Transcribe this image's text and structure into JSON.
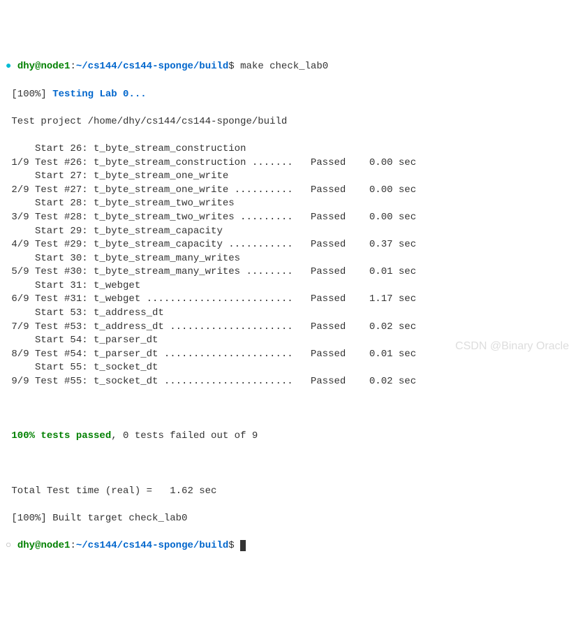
{
  "prompt": {
    "bullet1": "●",
    "bullet2": "○",
    "user": "dhy",
    "at": "@",
    "host": "node1",
    "colon": ":",
    "path": "~/cs144/cs144-sponge/build",
    "dollar": "$",
    "command": "make check_lab0"
  },
  "progress": {
    "label": "[100%]",
    "text": "Testing Lab 0..."
  },
  "project_line": "Test project /home/dhy/cs144/cs144-sponge/build",
  "tests": [
    {
      "start": "    Start 26: t_byte_stream_construction",
      "row": "1/9 Test #26: t_byte_stream_construction .......   Passed    0.00 sec"
    },
    {
      "start": "    Start 27: t_byte_stream_one_write",
      "row": "2/9 Test #27: t_byte_stream_one_write ..........   Passed    0.00 sec"
    },
    {
      "start": "    Start 28: t_byte_stream_two_writes",
      "row": "3/9 Test #28: t_byte_stream_two_writes .........   Passed    0.00 sec"
    },
    {
      "start": "    Start 29: t_byte_stream_capacity",
      "row": "4/9 Test #29: t_byte_stream_capacity ...........   Passed    0.37 sec"
    },
    {
      "start": "    Start 30: t_byte_stream_many_writes",
      "row": "5/9 Test #30: t_byte_stream_many_writes ........   Passed    0.01 sec"
    },
    {
      "start": "    Start 31: t_webget",
      "row": "6/9 Test #31: t_webget .........................   Passed    1.17 sec"
    },
    {
      "start": "    Start 53: t_address_dt",
      "row": "7/9 Test #53: t_address_dt .....................   Passed    0.02 sec"
    },
    {
      "start": "    Start 54: t_parser_dt",
      "row": "8/9 Test #54: t_parser_dt ......................   Passed    0.01 sec"
    },
    {
      "start": "    Start 55: t_socket_dt",
      "row": "9/9 Test #55: t_socket_dt ......................   Passed    0.02 sec"
    }
  ],
  "summary": {
    "passed": "100% tests passed",
    "failed": ", 0 tests failed out of 9"
  },
  "total_time": "Total Test time (real) =   1.62 sec",
  "built_target": "[100%] Built target check_lab0",
  "watermark": "CSDN @Binary Oracle"
}
